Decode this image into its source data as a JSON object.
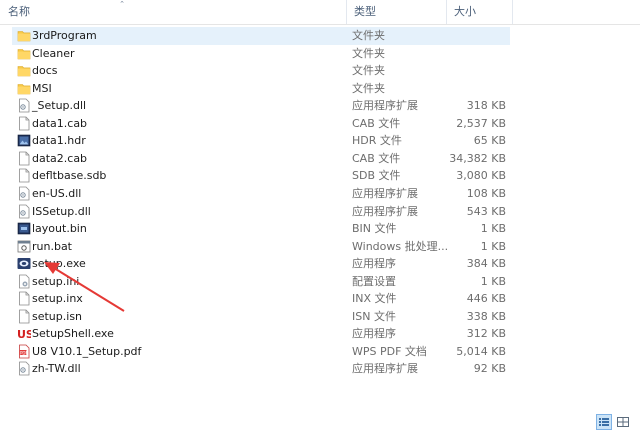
{
  "columns": {
    "name": "名称",
    "type": "类型",
    "size": "大小"
  },
  "files": [
    {
      "name": "3rdProgram",
      "type": "文件夹",
      "size": "",
      "icon": "folder-icon",
      "selected": true
    },
    {
      "name": "Cleaner",
      "type": "文件夹",
      "size": "",
      "icon": "folder-icon"
    },
    {
      "name": "docs",
      "type": "文件夹",
      "size": "",
      "icon": "folder-icon"
    },
    {
      "name": "MSI",
      "type": "文件夹",
      "size": "",
      "icon": "folder-icon"
    },
    {
      "name": "_Setup.dll",
      "type": "应用程序扩展",
      "size": "318 KB",
      "icon": "dll-icon"
    },
    {
      "name": "data1.cab",
      "type": "CAB 文件",
      "size": "2,537 KB",
      "icon": "file-icon"
    },
    {
      "name": "data1.hdr",
      "type": "HDR 文件",
      "size": "65 KB",
      "icon": "image-file-icon"
    },
    {
      "name": "data2.cab",
      "type": "CAB 文件",
      "size": "34,382 KB",
      "icon": "file-icon"
    },
    {
      "name": "defltbase.sdb",
      "type": "SDB 文件",
      "size": "3,080 KB",
      "icon": "file-icon"
    },
    {
      "name": "en-US.dll",
      "type": "应用程序扩展",
      "size": "108 KB",
      "icon": "dll-icon"
    },
    {
      "name": "ISSetup.dll",
      "type": "应用程序扩展",
      "size": "543 KB",
      "icon": "dll-icon"
    },
    {
      "name": "layout.bin",
      "type": "BIN 文件",
      "size": "1 KB",
      "icon": "bin-file-icon"
    },
    {
      "name": "run.bat",
      "type": "Windows 批处理...",
      "size": "1 KB",
      "icon": "batch-file-icon"
    },
    {
      "name": "setup.exe",
      "type": "应用程序",
      "size": "384 KB",
      "icon": "setup-exe-icon"
    },
    {
      "name": "setup.ini",
      "type": "配置设置",
      "size": "1 KB",
      "icon": "ini-file-icon"
    },
    {
      "name": "setup.inx",
      "type": "INX 文件",
      "size": "446 KB",
      "icon": "file-icon"
    },
    {
      "name": "setup.isn",
      "type": "ISN 文件",
      "size": "338 KB",
      "icon": "file-icon"
    },
    {
      "name": "SetupShell.exe",
      "type": "应用程序",
      "size": "312 KB",
      "icon": "us-app-icon"
    },
    {
      "name": "U8 V10.1_Setup.pdf",
      "type": "WPS PDF 文档",
      "size": "5,014 KB",
      "icon": "pdf-icon"
    },
    {
      "name": "zh-TW.dll",
      "type": "应用程序扩展",
      "size": "92 KB",
      "icon": "dll-icon"
    }
  ],
  "colors": {
    "accent_arrow": "#e53935",
    "selection": "#e5f1fb",
    "folder": "#f7c948"
  },
  "view_buttons": [
    "details-view-icon",
    "large-icons-view-icon"
  ]
}
